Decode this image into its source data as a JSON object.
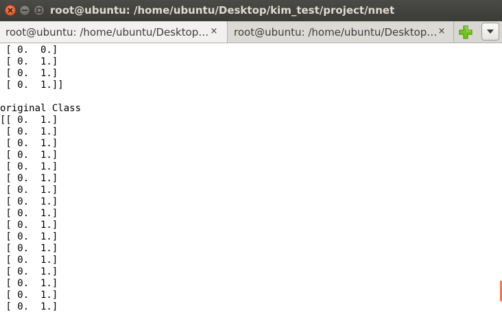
{
  "window": {
    "title": "root@ubuntu: /home/ubuntu/Desktop/kim_test/project/nnet"
  },
  "tabs": [
    {
      "label": "root@ubuntu: /home/ubuntu/Desktop…",
      "close_glyph": "×",
      "active": true
    },
    {
      "label": "root@ubuntu: /home/ubuntu/Desktop…",
      "close_glyph": "×",
      "active": false
    }
  ],
  "toolbar": {
    "new_tab_icon": "plus-icon",
    "menu_icon": "chevron-down-icon"
  },
  "colors": {
    "accent": "#df4b16",
    "new_tab_green": "#4e9a06",
    "scroll_marker": "#f07746"
  },
  "terminal": {
    "lines": [
      " [ 0.  0.]",
      " [ 0.  1.]",
      " [ 0.  1.]",
      " [ 0.  1.]]",
      "",
      "original Class",
      "[[ 0.  1.]",
      " [ 0.  1.]",
      " [ 0.  1.]",
      " [ 0.  1.]",
      " [ 0.  1.]",
      " [ 0.  1.]",
      " [ 0.  1.]",
      " [ 0.  1.]",
      " [ 0.  1.]",
      " [ 0.  1.]",
      " [ 0.  1.]",
      " [ 0.  1.]",
      " [ 0.  1.]",
      " [ 0.  1.]",
      " [ 0.  1.]",
      " [ 0.  1.]",
      " [ 0.  1.]"
    ]
  }
}
